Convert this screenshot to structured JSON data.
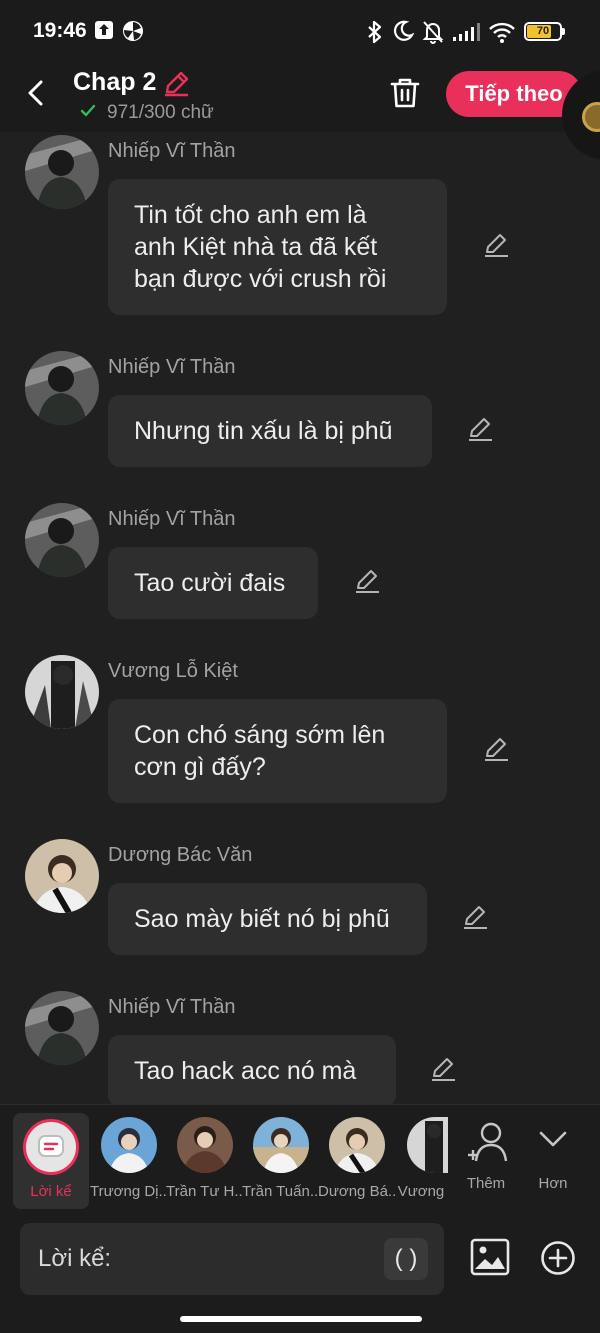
{
  "status_bar": {
    "time": "19:46",
    "battery": "70",
    "battery_level": 0.7,
    "left_icons": [
      "upload-icon",
      "pinwheel-icon"
    ],
    "right_icons": [
      "bluetooth-icon",
      "moon-icon",
      "bell-off-icon",
      "signal-icon",
      "wifi-icon",
      "battery-icon"
    ]
  },
  "header": {
    "title": "Chap 2",
    "word_count": "971/300 chữ",
    "next_label": "Tiếp theo",
    "icons": [
      "back-icon",
      "pencil-icon",
      "check-icon",
      "trash-icon"
    ]
  },
  "messages": [
    {
      "speaker": "Nhiếp Vĩ Thần",
      "text": "Tin tốt cho anh em là\nanh Kiệt nhà ta đã kết\nbạn được với crush rồi"
    },
    {
      "speaker": "Nhiếp Vĩ Thần",
      "text": "Nhưng tin xấu là bị phũ"
    },
    {
      "speaker": "Nhiếp Vĩ Thần",
      "text": "Tao cười đais"
    },
    {
      "speaker": "Vương Lỗ Kiệt",
      "text": "Con chó sáng sớm lên\ncơn gì đấy?"
    },
    {
      "speaker": "Dương Bác Văn",
      "text": "Sao mày biết nó bị phũ"
    },
    {
      "speaker": "Nhiếp Vĩ Thần",
      "text": "Tao hack acc nó mà"
    }
  ],
  "character_bar": {
    "narrator_label": "Lời kể",
    "characters": [
      {
        "name": "Trương Dị..."
      },
      {
        "name": "Trần Tư H..."
      },
      {
        "name": "Trần Tuấn..."
      },
      {
        "name": "Dương Bá..."
      },
      {
        "name": "Vương"
      }
    ],
    "add_label": "Thêm",
    "more_label": "Hơn"
  },
  "input": {
    "label": "Lời kể:",
    "paren_label": "( )"
  },
  "colors": {
    "accent": "#e8305a",
    "background": "#202020",
    "bubble": "#2e2e2e",
    "battery": "#f2c12e",
    "check": "#2fbf5a"
  }
}
